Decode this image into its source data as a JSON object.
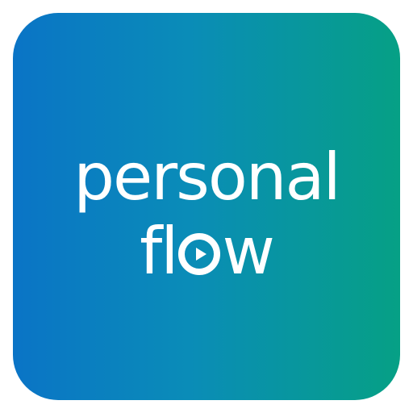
{
  "logo": {
    "line1": "personal",
    "line2_prefix": "fl",
    "line2_suffix": "w",
    "play_icon": "play-circle-icon",
    "gradient": [
      "#0a74c6",
      "#06a085"
    ]
  }
}
